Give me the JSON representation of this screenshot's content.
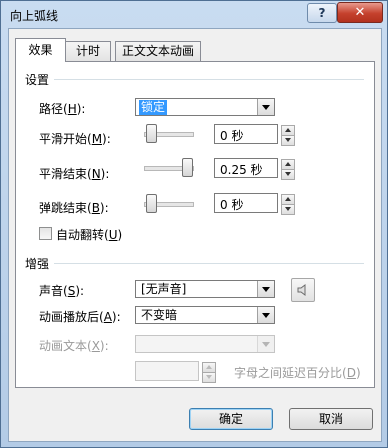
{
  "window": {
    "title": "向上弧线",
    "help_label": "?",
    "close_label": "✕"
  },
  "tabs": [
    {
      "label": "效果"
    },
    {
      "label": "计时"
    },
    {
      "label": "正文文本动画"
    }
  ],
  "settings": {
    "heading": "设置",
    "path": {
      "label_pre": "路径(",
      "label_key": "H",
      "label_post": "):",
      "value": "锁定"
    },
    "smooth_start": {
      "label_pre": "平滑开始(",
      "label_key": "M",
      "label_post": "):",
      "value": "0 秒",
      "level": 0
    },
    "smooth_end": {
      "label_pre": "平滑结束(",
      "label_key": "N",
      "label_post": "):",
      "value": "0.25 秒",
      "level": 1
    },
    "bounce_end": {
      "label_pre": "弹跳结束(",
      "label_key": "B",
      "label_post": "):",
      "value": "0 秒",
      "level": 0
    },
    "auto_reverse": {
      "label_pre": "自动翻转(",
      "label_key": "U",
      "label_post": ")",
      "checked": false
    }
  },
  "enhancements": {
    "heading": "增强",
    "sound": {
      "label_pre": "声音(",
      "label_key": "S",
      "label_post": "):",
      "value": "[无声音]"
    },
    "after_animation": {
      "label_pre": "动画播放后(",
      "label_key": "A",
      "label_post": "):",
      "value": "不变暗"
    },
    "animate_text": {
      "label_pre": "动画文本(",
      "label_key": "X",
      "label_post": "):",
      "value": ""
    },
    "letter_delay": {
      "value": "",
      "label_pre": "字母之间延迟百分比(",
      "label_key": "D",
      "label_post": ")"
    }
  },
  "buttons": {
    "ok": "确定",
    "cancel": "取消"
  },
  "colors": {
    "selection": "#3399ff",
    "title_bar": "#c9dcf1",
    "close_button": "#c5412d"
  }
}
